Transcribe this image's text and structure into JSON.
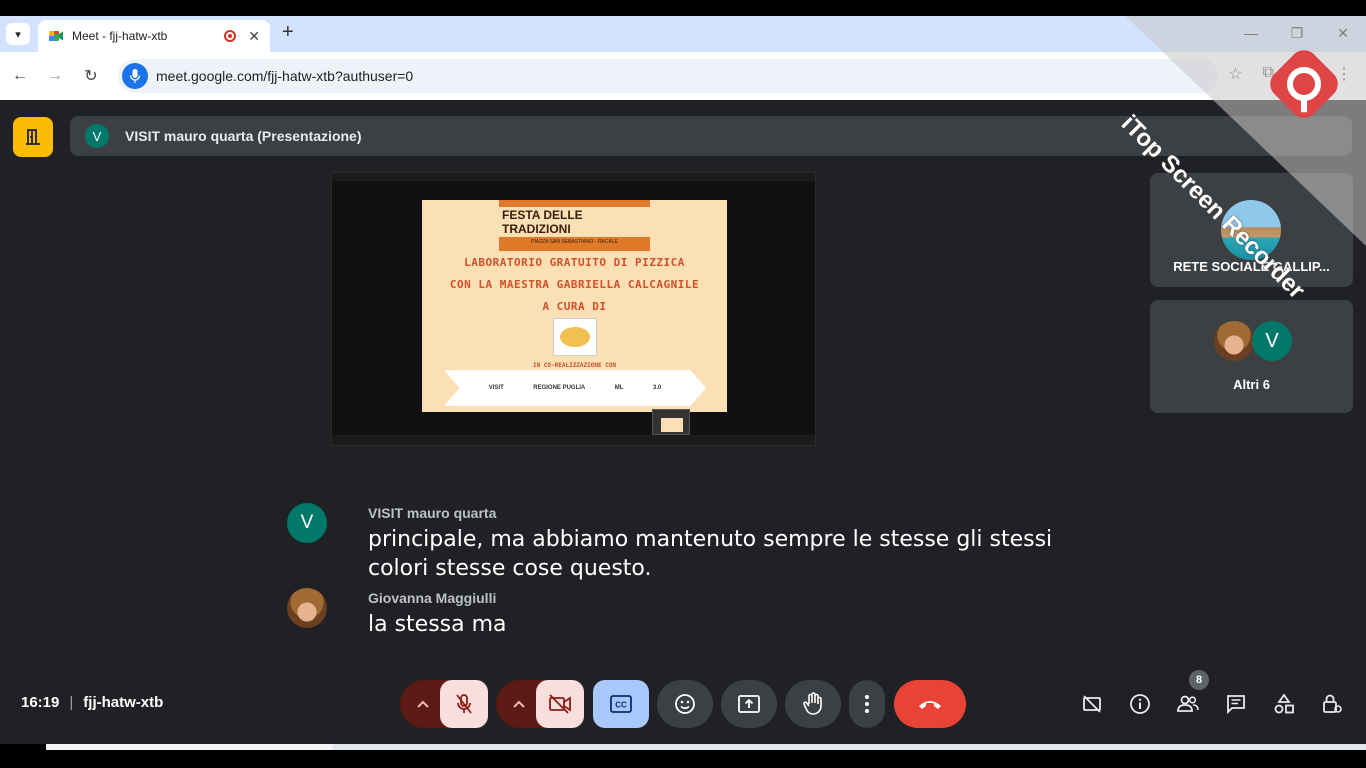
{
  "browser": {
    "tab_title": "Meet - fjj-hatw-xtb",
    "url": "meet.google.com/fjj-hatw-xtb?authuser=0",
    "new_tab_symbol": "+",
    "close_tab_symbol": "✕"
  },
  "meet": {
    "presentation_bar": {
      "avatar_letter": "V",
      "title": "VISIT mauro quarta (Presentazione)"
    },
    "slide": {
      "heading": "FESTA DELLE TRADIZIONI",
      "subheading": "PIAZZA SAN SEBASTIANO - RACALE",
      "lines": [
        "LABORATORIO GRATUITO DI PIZZICA",
        "CON LA MAESTRA GABRIELLA CALCAGNILE",
        "A CURA DI"
      ],
      "coreal": "IN CO-REALIZZAZIONE CON",
      "partners": [
        "VISIT",
        "REGIONE PUGLIA",
        "ML",
        "3.0"
      ]
    },
    "tiles": [
      {
        "name": "RETE SOCIALE GALLIP..."
      },
      {
        "name": "Altri 6",
        "avatar_letter": "V"
      }
    ],
    "captions": [
      {
        "avatar_letter": "V",
        "speaker": "VISIT mauro quarta",
        "text": "principale, ma abbiamo mantenuto sempre le stesse gli stessi colori stesse cose questo."
      },
      {
        "speaker": "Giovanna Maggiulli",
        "text": "la stessa ma"
      }
    ],
    "meeting_info": {
      "time": "16:19",
      "code": "fjj-hatw-xtb"
    },
    "participants_count": "8",
    "colors": {
      "background": "#202124",
      "tile": "#3c4043",
      "end_call": "#ea4335",
      "captions_on": "#a8c7fa",
      "muted": "#f9dedc",
      "host_controls": "#fbbc04"
    }
  },
  "watermark": {
    "text": "iTop Screen Recorder"
  }
}
